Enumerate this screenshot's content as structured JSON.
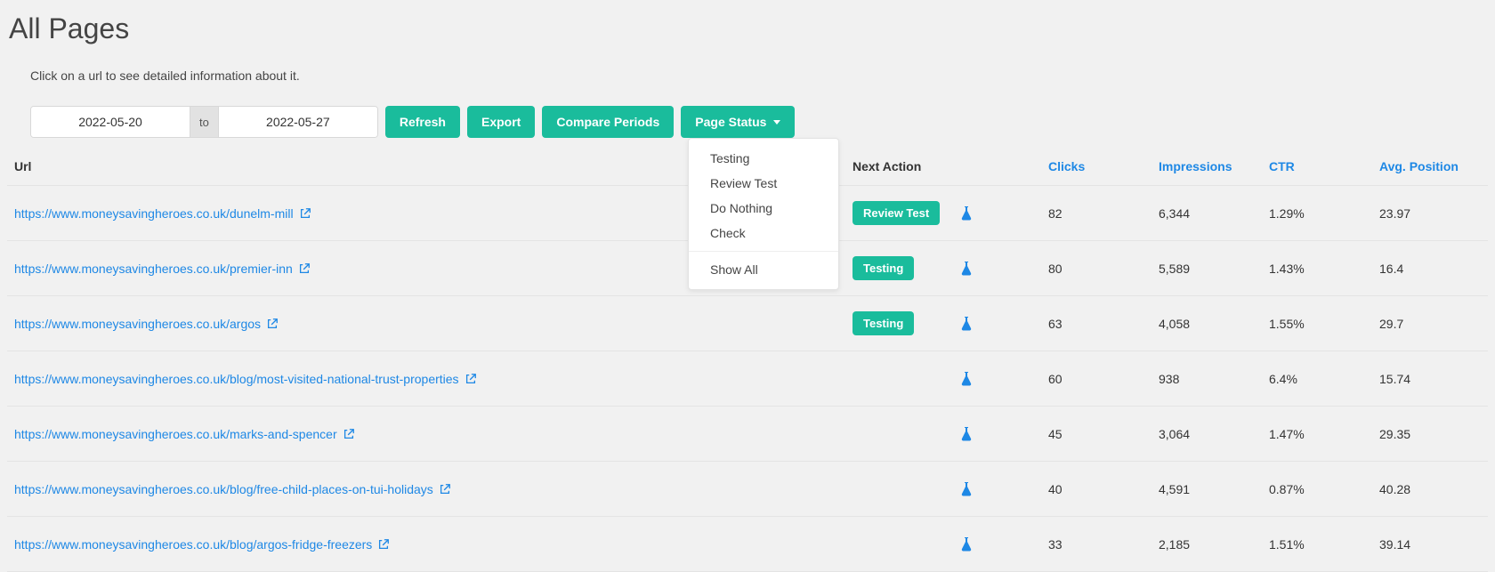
{
  "page": {
    "title": "All Pages",
    "hint": "Click on a url to see detailed information about it."
  },
  "controls": {
    "date_from": "2022-05-20",
    "date_sep": "to",
    "date_to": "2022-05-27",
    "refresh": "Refresh",
    "export": "Export",
    "compare": "Compare Periods",
    "page_status": "Page Status",
    "dropdown": {
      "testing": "Testing",
      "review_test": "Review Test",
      "do_nothing": "Do Nothing",
      "check": "Check",
      "show_all": "Show All"
    }
  },
  "columns": {
    "url": "Url",
    "next_action": "Next Action",
    "clicks": "Clicks",
    "impressions": "Impressions",
    "ctr": "CTR",
    "avg_position": "Avg. Position"
  },
  "rows": [
    {
      "url": "https://www.moneysavingheroes.co.uk/dunelm-mill",
      "next_action": "Review Test",
      "clicks": "82",
      "impressions": "6,344",
      "ctr": "1.29%",
      "pos": "23.97"
    },
    {
      "url": "https://www.moneysavingheroes.co.uk/premier-inn",
      "next_action": "Testing",
      "clicks": "80",
      "impressions": "5,589",
      "ctr": "1.43%",
      "pos": "16.4"
    },
    {
      "url": "https://www.moneysavingheroes.co.uk/argos",
      "next_action": "Testing",
      "clicks": "63",
      "impressions": "4,058",
      "ctr": "1.55%",
      "pos": "29.7"
    },
    {
      "url": "https://www.moneysavingheroes.co.uk/blog/most-visited-national-trust-properties",
      "next_action": "",
      "clicks": "60",
      "impressions": "938",
      "ctr": "6.4%",
      "pos": "15.74"
    },
    {
      "url": "https://www.moneysavingheroes.co.uk/marks-and-spencer",
      "next_action": "",
      "clicks": "45",
      "impressions": "3,064",
      "ctr": "1.47%",
      "pos": "29.35"
    },
    {
      "url": "https://www.moneysavingheroes.co.uk/blog/free-child-places-on-tui-holidays",
      "next_action": "",
      "clicks": "40",
      "impressions": "4,591",
      "ctr": "0.87%",
      "pos": "40.28"
    },
    {
      "url": "https://www.moneysavingheroes.co.uk/blog/argos-fridge-freezers",
      "next_action": "",
      "clicks": "33",
      "impressions": "2,185",
      "ctr": "1.51%",
      "pos": "39.14"
    }
  ]
}
